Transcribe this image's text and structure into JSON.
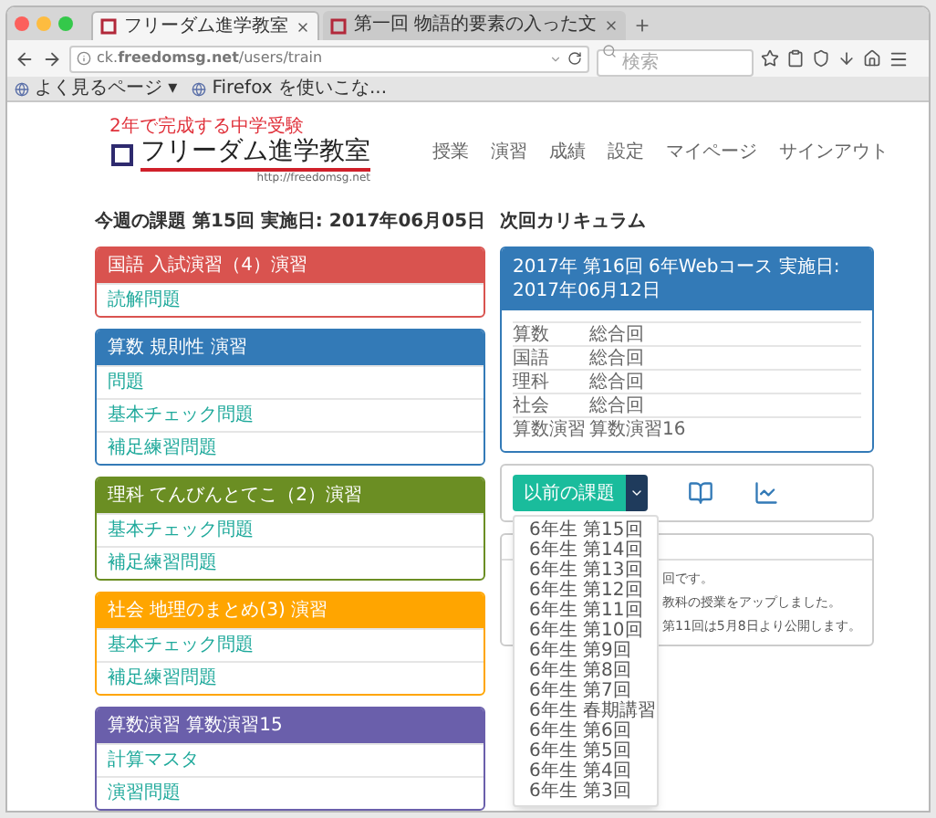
{
  "browser": {
    "tabs": [
      {
        "title": "フリーダム進学教室",
        "selected": true
      },
      {
        "title": "第一回 物語的要素の入った文",
        "selected": false
      }
    ],
    "url": "ck.**freedomsg.net**/users/train",
    "search_placeholder": "検索",
    "bookmarks": [
      "よく見るページ ▾",
      "Firefox を使いこな..."
    ]
  },
  "site": {
    "tagline": "2年で完成する中学受験",
    "name": "フリーダム進学教室",
    "url": "http://freedomsg.net",
    "nav": [
      "授業",
      "演習",
      "成績",
      "設定",
      "マイページ",
      "サインアウト"
    ]
  },
  "this_week": {
    "title": "今週の課題 第15回 実施日: 2017年06月05日",
    "cards": [
      {
        "title": "国語 入試演習（4）演習",
        "color": "#d9534f",
        "items": [
          "読解問題"
        ]
      },
      {
        "title": "算数 規則性 演習",
        "color": "#337ab7",
        "items": [
          "問題",
          "基本チェック問題",
          "補足練習問題"
        ]
      },
      {
        "title": "理科 てんびんとてこ（2）演習",
        "color": "#6b8e23",
        "items": [
          "基本チェック問題",
          "補足練習問題"
        ]
      },
      {
        "title": "社会 地理のまとめ(3) 演習",
        "color": "#ffa500",
        "items": [
          "基本チェック問題",
          "補足練習問題"
        ]
      },
      {
        "title": "算数演習 算数演習15",
        "color": "#6a5fab",
        "items": [
          "計算マスタ",
          "演習問題"
        ]
      }
    ]
  },
  "next": {
    "title": "次回カリキュラム",
    "header": "2017年 第16回 6年Webコース 実施日: 2017年06月12日",
    "rows": [
      {
        "subject": "算数",
        "content": "総合回"
      },
      {
        "subject": "国語",
        "content": "総合回"
      },
      {
        "subject": "理科",
        "content": "総合回"
      },
      {
        "subject": "社会",
        "content": "総合回"
      },
      {
        "subject": "算数演習",
        "content": "算数演習16"
      }
    ]
  },
  "actions": {
    "button": "以前の課題",
    "menu": [
      "6年生 第15回",
      "6年生 第14回",
      "6年生 第13回",
      "6年生 第12回",
      "6年生 第11回",
      "6年生 第10回",
      "6年生 第9回",
      "6年生 第8回",
      "6年生 第7回",
      "6年生 春期講習",
      "6年生 第6回",
      "6年生 第5回",
      "6年生 第4回",
      "6年生 第3回"
    ]
  },
  "notice": {
    "lines": [
      "回です。",
      "教科の授業をアップしました。",
      "第11回は5月8日より公開します。"
    ]
  }
}
